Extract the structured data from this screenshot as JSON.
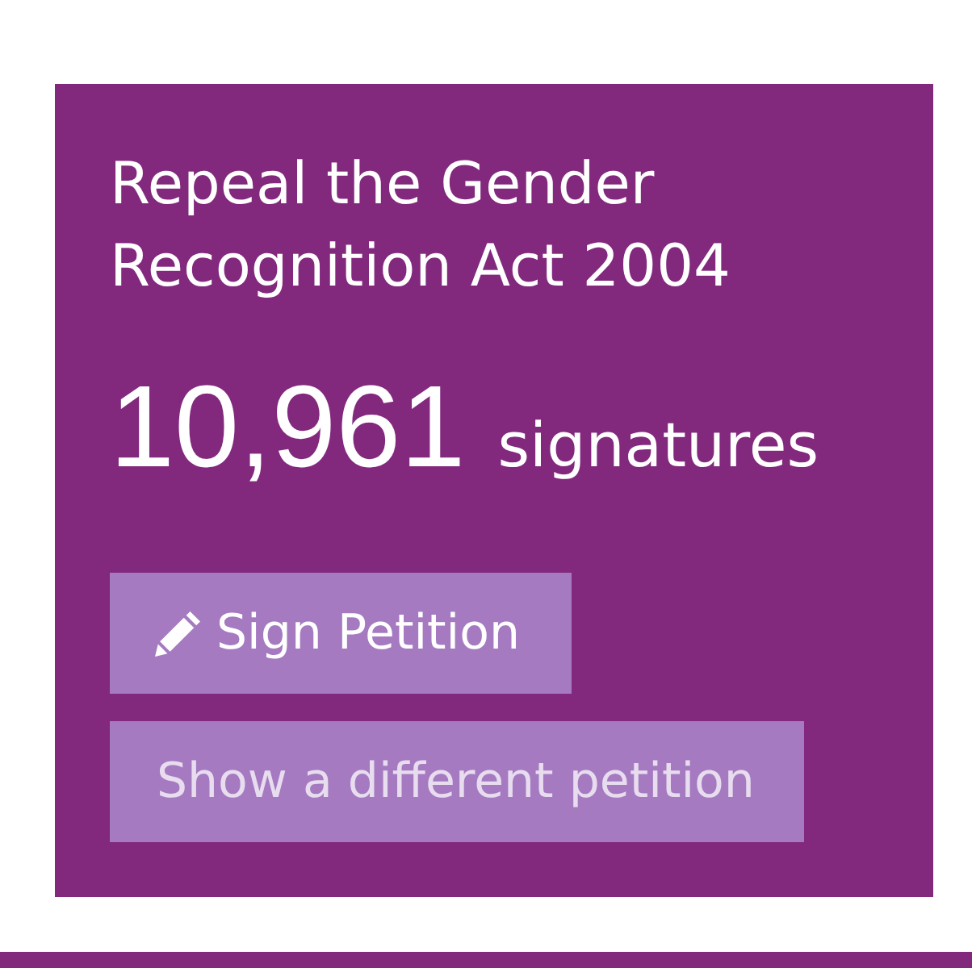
{
  "petition": {
    "title": "Repeal the Gender Recognition Act 2004",
    "count": "10,961",
    "count_label": "signatures"
  },
  "buttons": [
    {
      "kind": "primary",
      "label": "Sign Petition"
    },
    {
      "kind": "secondary",
      "label": "Show a different petition"
    }
  ]
}
